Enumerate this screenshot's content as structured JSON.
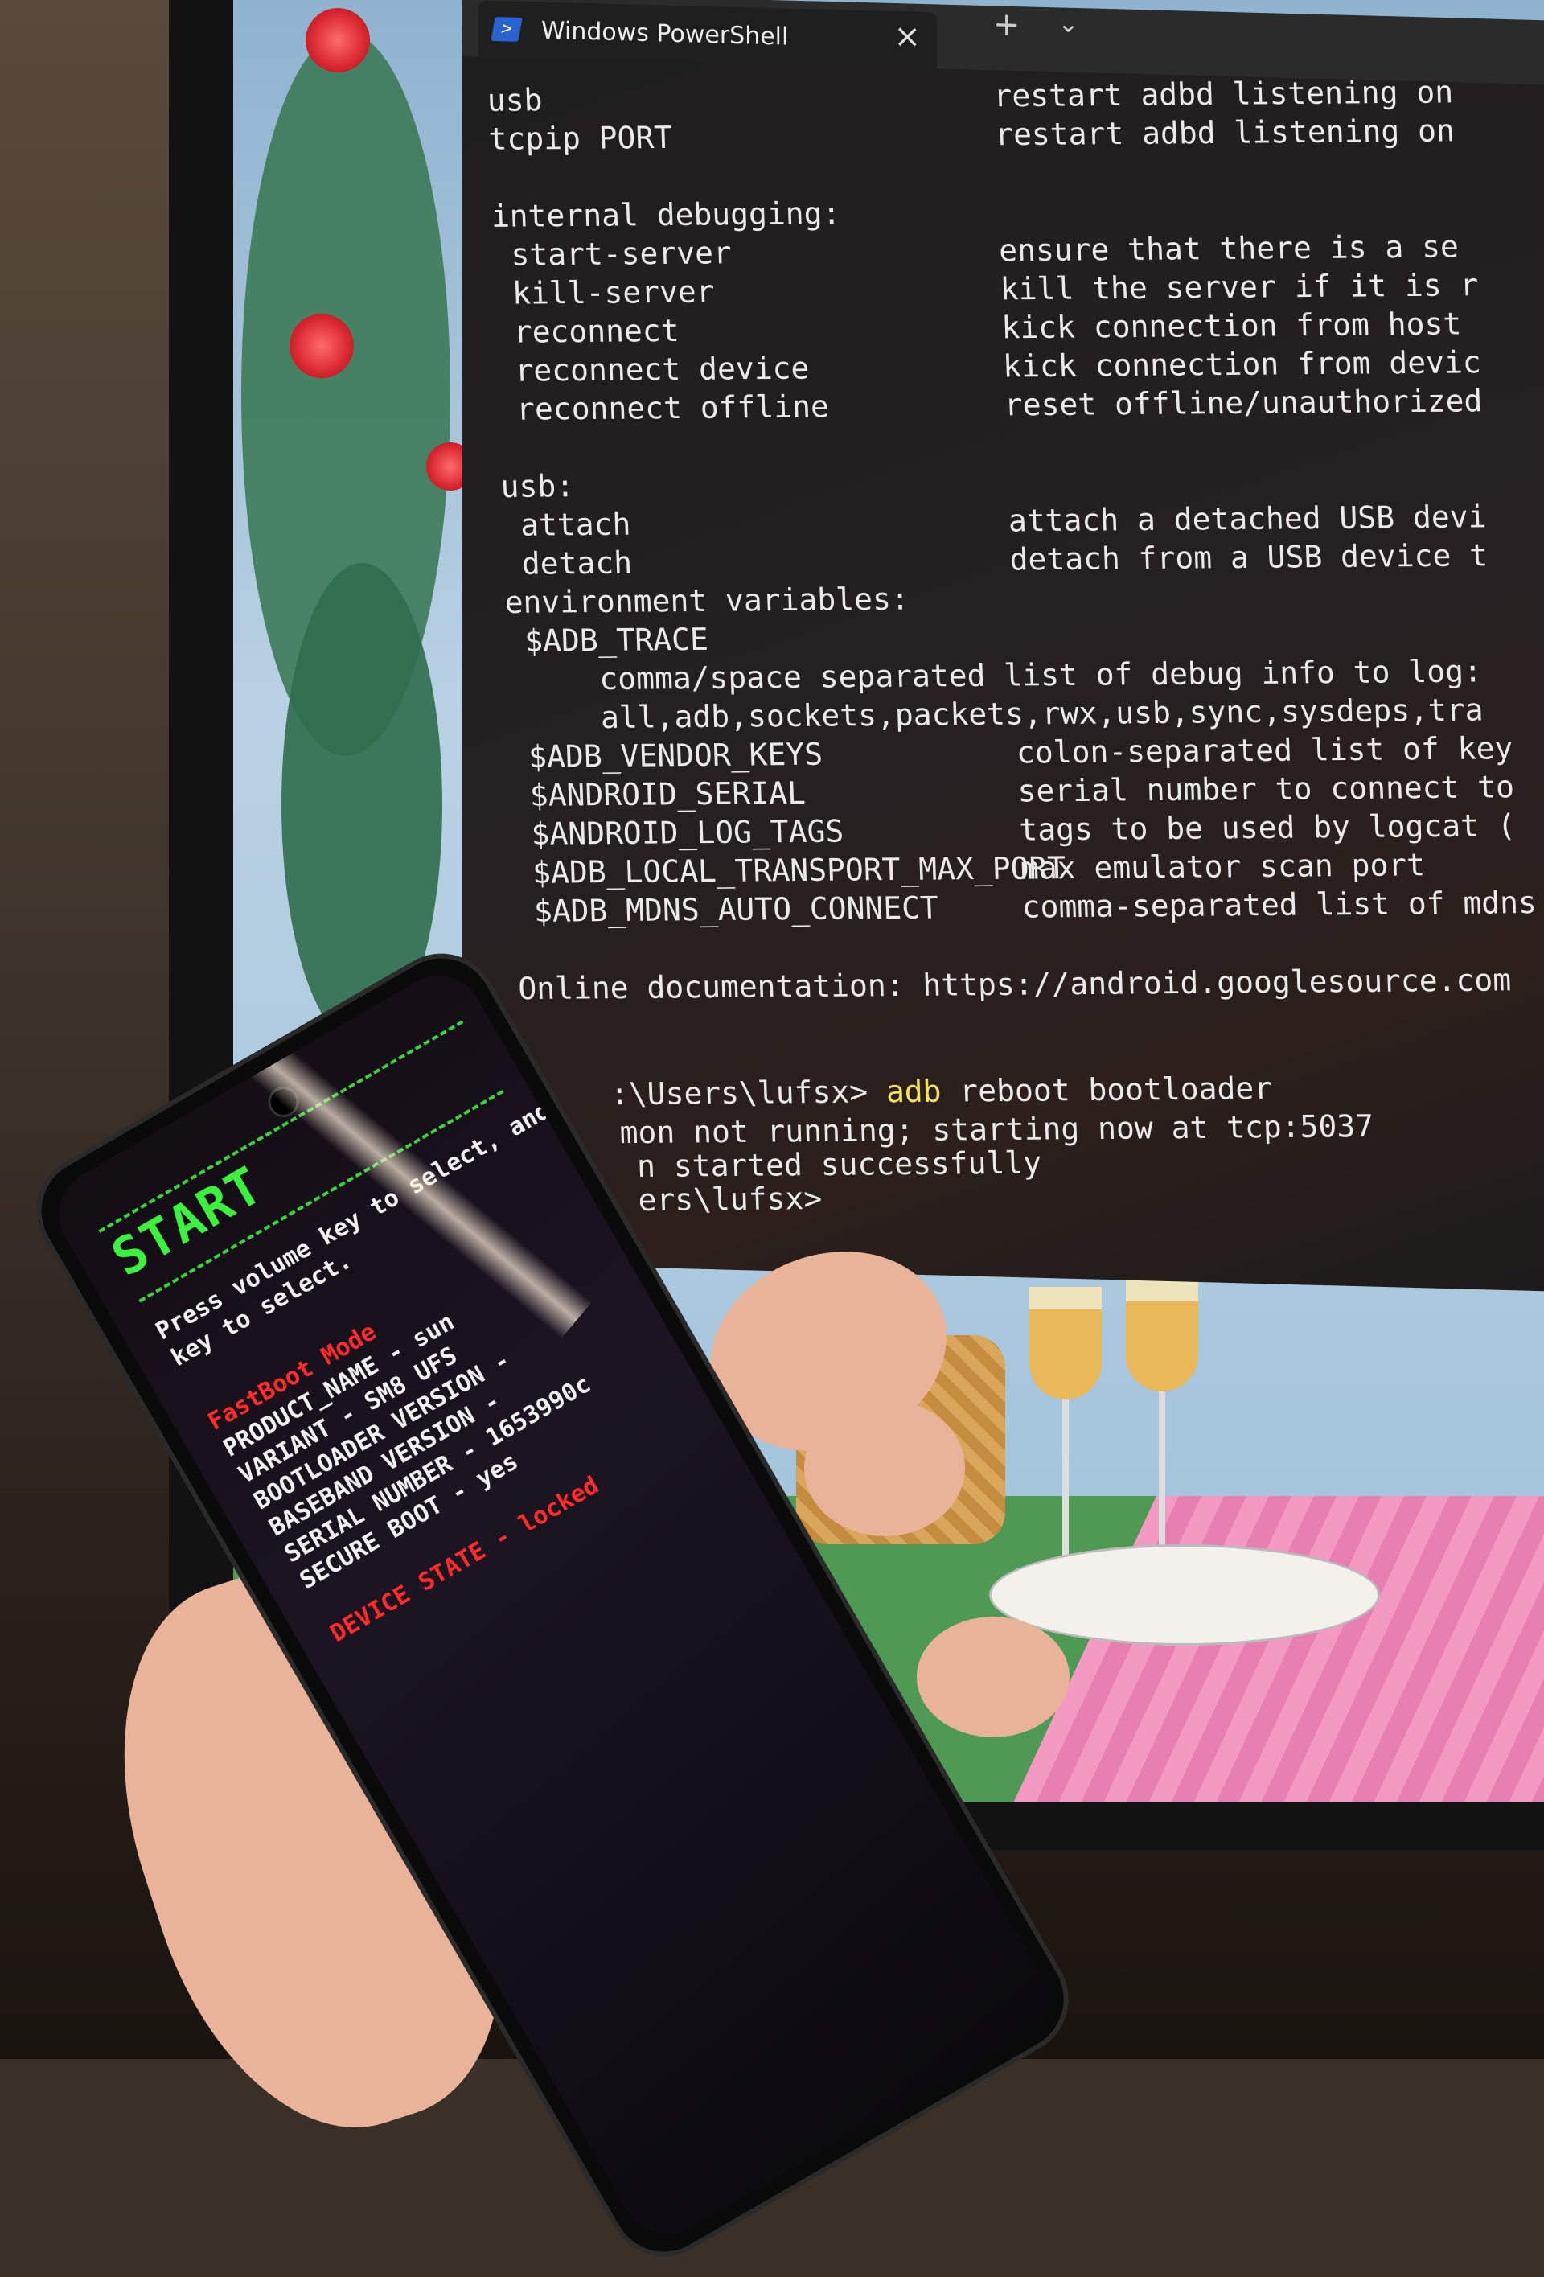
{
  "terminal": {
    "tab_title": "Windows PowerShell",
    "tab_icon": "powershell-icon",
    "close_label": "×",
    "new_tab_label": "+",
    "dropdown_label": "⌄",
    "lines": [
      {
        "left": "usb",
        "right": "restart adbd listening on"
      },
      {
        "left": "tcpip PORT",
        "right": "restart adbd listening on"
      },
      {
        "left": "",
        "right": ""
      },
      {
        "left": "internal debugging:",
        "right": ""
      },
      {
        "left": " start-server",
        "right": "ensure that there is a se"
      },
      {
        "left": " kill-server",
        "right": "kill the server if it is r"
      },
      {
        "left": " reconnect",
        "right": "kick connection from host"
      },
      {
        "left": " reconnect device",
        "right": "kick connection from devic"
      },
      {
        "left": " reconnect offline",
        "right": "reset offline/unauthorized"
      },
      {
        "left": "",
        "right": ""
      },
      {
        "left": "usb:",
        "right": ""
      },
      {
        "left": " attach",
        "right": "attach a detached USB devi"
      },
      {
        "left": " detach",
        "right": "detach from a USB device t"
      },
      {
        "left": "environment variables:",
        "right": ""
      },
      {
        "left": " $ADB_TRACE",
        "right": ""
      },
      {
        "left": "     comma/space separated list of debug info to log:",
        "right": ""
      },
      {
        "left": "     all,adb,sockets,packets,rwx,usb,sync,sysdeps,tra",
        "right": ""
      },
      {
        "left": " $ADB_VENDOR_KEYS",
        "right": "colon-separated list of key"
      },
      {
        "left": " $ANDROID_SERIAL",
        "right": "serial number to connect to"
      },
      {
        "left": " $ANDROID_LOG_TAGS",
        "right": "tags to be used by logcat ("
      },
      {
        "left": " $ADB_LOCAL_TRANSPORT_MAX_PORT",
        "right": "max emulator scan port"
      },
      {
        "left": " $ADB_MDNS_AUTO_CONNECT",
        "right": "comma-separated list of mdns"
      },
      {
        "left": "",
        "right": ""
      },
      {
        "left": "Online documentation: https://android.googlesource.com",
        "right": ""
      }
    ],
    "prompt": ":\\Users\\lufsx> ",
    "command_name": "adb",
    "command_args": " reboot bootloader",
    "output": [
      "mon not running; starting now at tcp:5037",
      "n started successfully",
      "ers\\lufsx>"
    ]
  },
  "phone": {
    "title": "START",
    "instructions": [
      "Press volume key to select, and press po",
      "key to select."
    ],
    "mode": "FastBoot Mode",
    "info": [
      "PRODUCT_NAME - sun",
      "VARIANT - SM8 UFS",
      "BOOTLOADER VERSION -",
      "BASEBAND VERSION -",
      "SERIAL NUMBER - 1653990c",
      "SECURE BOOT - yes"
    ],
    "device_state_label": "DEVICE STATE - ",
    "device_state_value": "locked",
    "colors": {
      "title": "#3cf03e",
      "mode": "#ff2a2a",
      "text": "#f2f2f2"
    }
  }
}
